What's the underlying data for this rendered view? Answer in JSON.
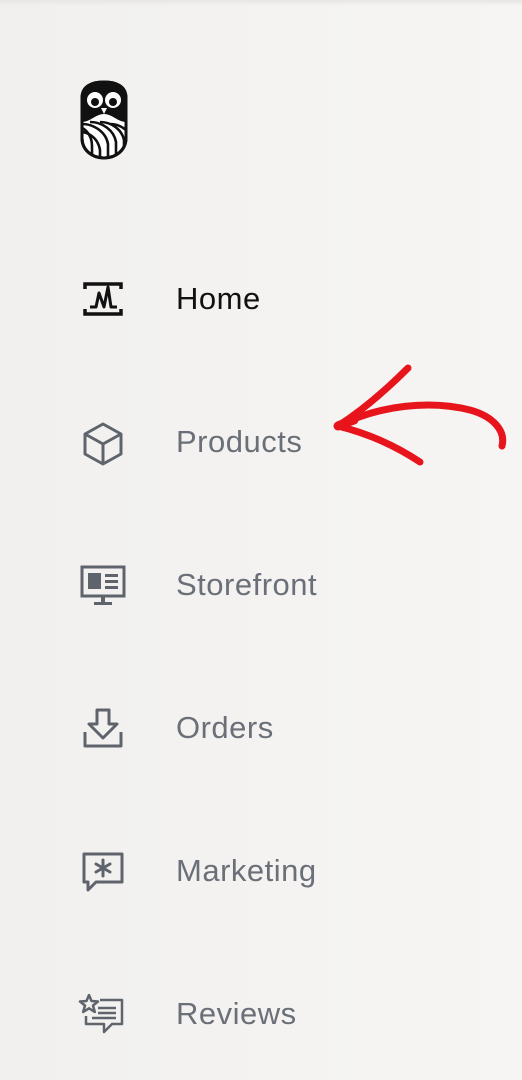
{
  "nav": {
    "items": [
      {
        "label": "Home",
        "icon": "home-chart-icon",
        "active": true
      },
      {
        "label": "Products",
        "icon": "box-icon",
        "active": false
      },
      {
        "label": "Storefront",
        "icon": "storefront-monitor-icon",
        "active": false
      },
      {
        "label": "Orders",
        "icon": "download-tray-icon",
        "active": false
      },
      {
        "label": "Marketing",
        "icon": "speech-bubble-asterisk-icon",
        "active": false
      },
      {
        "label": "Reviews",
        "icon": "star-list-icon",
        "active": false
      }
    ]
  },
  "logo": {
    "icon": "owl-logo-icon"
  },
  "annotation": {
    "icon": "red-arrow-annotation",
    "color": "#e8141c"
  },
  "colors": {
    "background": "#f3f2f0",
    "active_text": "#111111",
    "inactive_text": "#6a6f78",
    "icon_active": "#111111",
    "icon_inactive": "#5f646c"
  }
}
